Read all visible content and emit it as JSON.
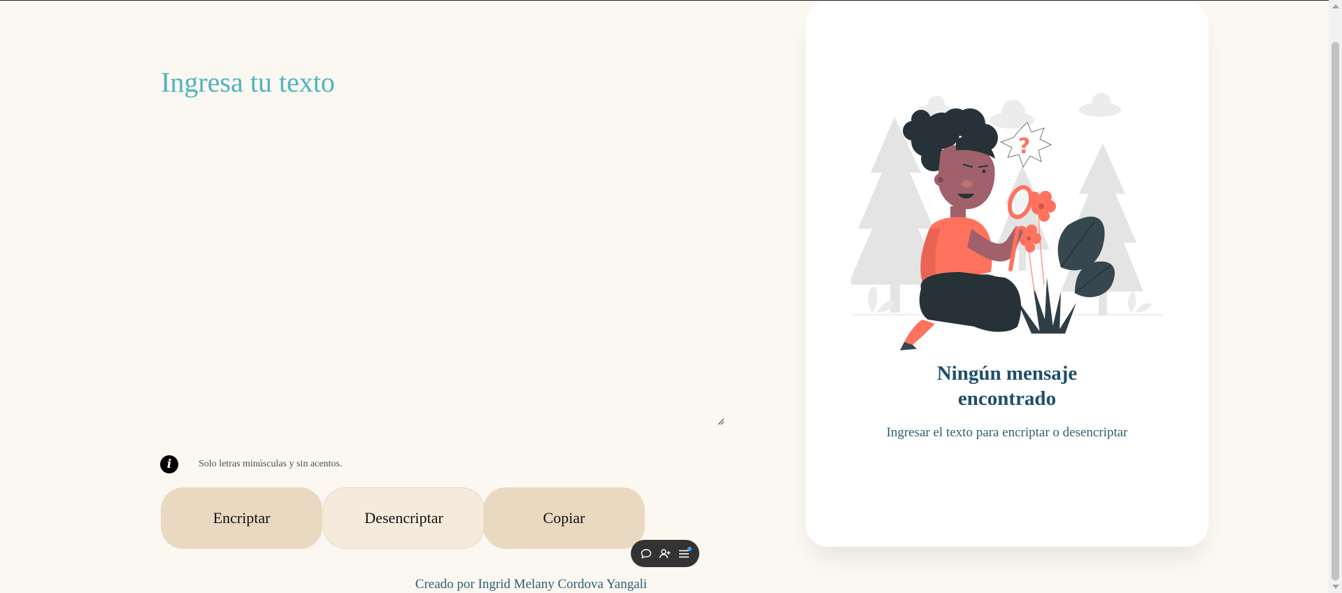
{
  "input": {
    "title": "Ingresa tu texto",
    "value": "",
    "placeholder": ""
  },
  "info": {
    "icon": "info-icon",
    "glyph": "i",
    "text": "Solo letras minúsculas y sin acentos."
  },
  "buttons": {
    "encrypt": "Encriptar",
    "decrypt": "Desencriptar",
    "copy": "Copiar"
  },
  "output": {
    "title_line1": "Ningún mensaje",
    "title_line2": "encontrado",
    "subtitle": "Ingresar el texto para encriptar o desencriptar"
  },
  "footer": {
    "text": "Creado por Ingrid Melany Cordova Yangali"
  },
  "colors": {
    "title": "#4fb3bf",
    "button_primary": "#e9d9c1",
    "button_secondary": "#f6eadc",
    "card_title": "#1f4e6b",
    "accent_coral": "#ff725e",
    "dark_navy": "#263238"
  },
  "floating_toolbar": {
    "icons": [
      "chat-bubble-icon",
      "add-person-icon",
      "menu-list-icon"
    ]
  }
}
